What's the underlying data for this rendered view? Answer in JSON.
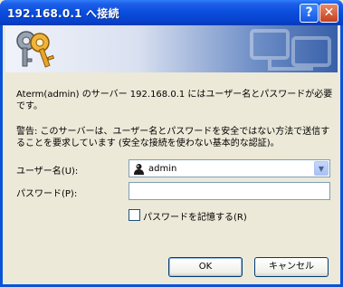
{
  "window": {
    "title": "192.168.0.1 へ接続",
    "help_glyph": "?",
    "close_glyph": "✕"
  },
  "banner": {
    "icon": "keys-icon",
    "watermark_icon": "network-watermark-icon"
  },
  "message": {
    "line1": "Aterm(admin) のサーバー 192.168.0.1 にはユーザー名とパスワードが必要です。",
    "warning": "警告: このサーバーは、ユーザー名とパスワードを安全ではない方法で送信することを要求しています (安全な接続を使わない基本的な認証)。"
  },
  "form": {
    "username_label": "ユーザー名(U):",
    "username_value": "admin",
    "username_icon": "user-icon",
    "password_label": "パスワード(P):",
    "password_value": "",
    "remember_label": "パスワードを記憶する(R)",
    "remember_checked": false
  },
  "buttons": {
    "ok": "OK",
    "cancel": "キャンセル"
  },
  "colors": {
    "title_bar": "#0a4fde",
    "dialog_bg": "#ece9d8",
    "close_button": "#c4401c"
  }
}
